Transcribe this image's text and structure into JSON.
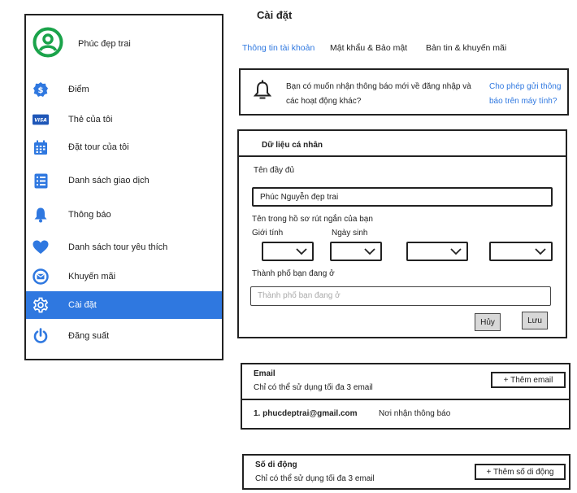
{
  "sidebar": {
    "profile_name": "Phúc đẹp trai",
    "items": [
      {
        "label": "Điểm",
        "icon": "dollar-badge-icon"
      },
      {
        "label": "Thẻ của tôi",
        "icon": "visa-card-icon",
        "icon_text": "VISA"
      },
      {
        "label": "Đặt tour của tôi",
        "icon": "calendar-icon"
      },
      {
        "label": "Danh sách giao dịch",
        "icon": "list-icon"
      },
      {
        "label": "Thông báo",
        "icon": "bell-icon"
      },
      {
        "label": "Danh sách tour yêu thích",
        "icon": "heart-icon"
      },
      {
        "label": "Khuyến mãi",
        "icon": "mail-icon"
      },
      {
        "label": "Cài đặt",
        "icon": "gear-icon"
      },
      {
        "label": "Đăng suất",
        "icon": "power-icon"
      }
    ]
  },
  "page": {
    "title": "Cài đặt"
  },
  "tabs": [
    "Thông tin tài khoản",
    "Mật khẩu & Bảo mật",
    "Bản tin & khuyến mãi"
  ],
  "notification": {
    "message": "Bạn có muốn nhận thông báo mới về đăng nhập và các hoạt động khác?",
    "allow_link": "Cho phép gửi thông báo trên máy tính?"
  },
  "personal": {
    "title": "Dữ liệu cá nhân",
    "fullname_label": "Tên đầy đủ",
    "fullname_value": "Phúc Nguyễn đẹp trai",
    "short_name_note": "Tên trong hồ sơ rút ngắn của bạn",
    "gender_label": "Giới tính",
    "birthday_label": "Ngày sinh",
    "city_label": "Thành phố bạn đang ở",
    "city_placeholder": "Thành phố bạn đang ở",
    "cancel": "Hủy",
    "save": "Lưu"
  },
  "email": {
    "title": "Email",
    "note": "Chỉ có thể sử dụng tối đa 3 email",
    "add_button": "+ Thêm email",
    "entries": [
      {
        "address": "1. phucdeptrai@gmail.com",
        "tag": "Nơi nhận thông báo"
      }
    ]
  },
  "phone": {
    "title": "Số di động",
    "note": "Chỉ có thể sử dụng tối đa 3 email",
    "add_button": "+ Thêm số di động"
  },
  "colors": {
    "accent": "#2f78e0",
    "avatar": "#1aa34a"
  }
}
